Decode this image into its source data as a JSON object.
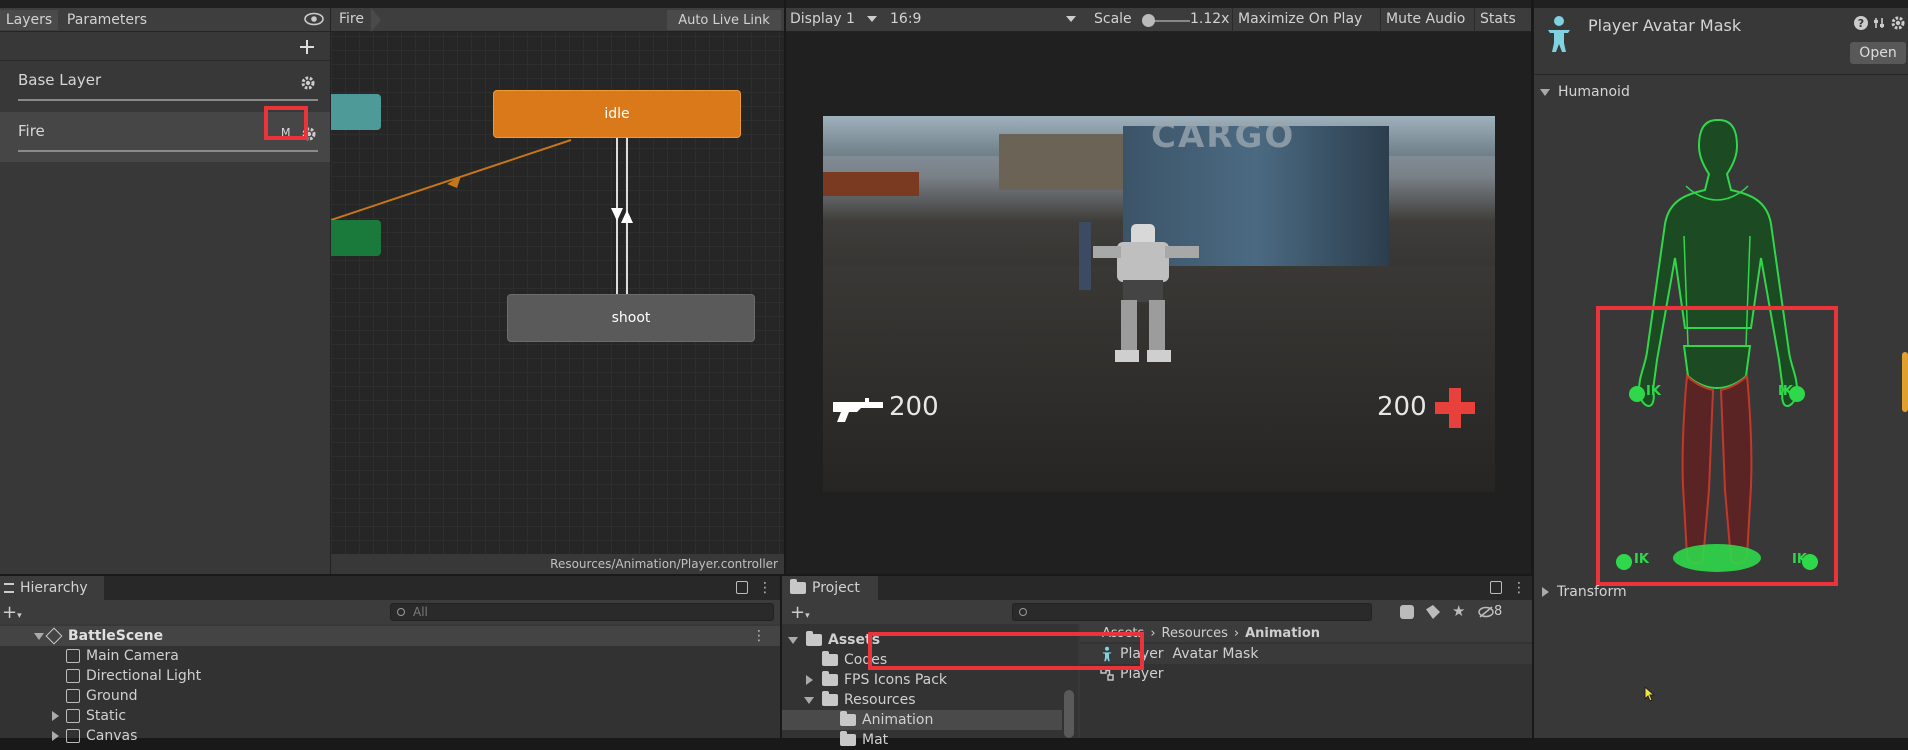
{
  "animator": {
    "tabs": {
      "layers": "Layers",
      "parameters": "Parameters"
    },
    "breadcrumb": "Fire",
    "auto_live_link": "Auto Live Link",
    "layers": [
      {
        "name": "Base Layer"
      },
      {
        "name": "Fire",
        "mask_badge": "M"
      }
    ],
    "states": {
      "idle": "idle",
      "shoot": "shoot"
    },
    "footer_path": "Resources/Animation/Player.controller"
  },
  "game": {
    "display": "Display 1",
    "aspect": "16:9",
    "scale_label": "Scale",
    "scale_value": "1.12x",
    "maximize": "Maximize On Play",
    "mute": "Mute Audio",
    "stats": "Stats",
    "hud": {
      "ammo": "200",
      "health": "200"
    },
    "scene_text": "CARGO"
  },
  "hierarchy": {
    "tab": "Hierarchy",
    "search_placeholder": "All",
    "scene": "BattleScene",
    "items": [
      "Main Camera",
      "Directional Light",
      "Ground",
      "Static",
      "Canvas"
    ]
  },
  "project": {
    "tab": "Project",
    "tree": [
      "Assets",
      "Codes",
      "FPS Icons Pack",
      "Resources",
      "Animation",
      "Mat"
    ],
    "breadcrumb": [
      "Assets",
      "Resources",
      "Animation"
    ],
    "files": [
      "Player  Avatar Mask",
      "Player"
    ],
    "hidden_count": "8"
  },
  "inspector": {
    "title": "Player  Avatar Mask",
    "open_button": "Open",
    "humanoid_label": "Humanoid",
    "transform_label": "Transform",
    "ik_label": "IK"
  },
  "colors": {
    "accent_red": "#e8343a",
    "idle_state": "#d9791a",
    "humanoid_green": "#2fd84a",
    "mask_red": "#c0392b"
  }
}
